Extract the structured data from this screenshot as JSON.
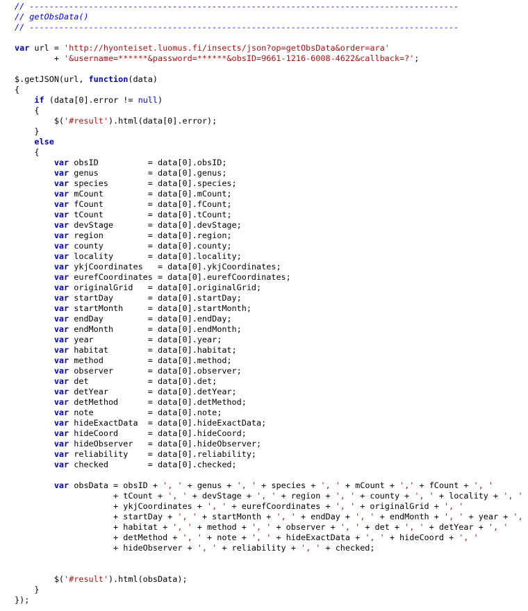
{
  "editor": {
    "lines": [
      [
        {
          "t": "comment",
          "v": "// ---------------------------------------------------------------------------------------"
        }
      ],
      [
        {
          "t": "comment",
          "v": "// getObsData()"
        }
      ],
      [
        {
          "t": "comment",
          "v": "// ---------------------------------------------------------------------------------------"
        }
      ],
      [],
      [
        {
          "t": "keyword",
          "v": "var"
        },
        {
          "t": "plain",
          "v": " url = "
        },
        {
          "t": "string",
          "v": "'http://hyonteiset.luomus.fi/insects/json?op=getObsData&order=ara'"
        }
      ],
      [
        {
          "t": "plain",
          "v": "        + "
        },
        {
          "t": "string",
          "v": "'&username=******&password=******&obsID=9661-1216-6008-4622&callback=?'"
        },
        {
          "t": "plain",
          "v": ";"
        }
      ],
      [],
      [
        {
          "t": "plain",
          "v": "$.getJSON(url, "
        },
        {
          "t": "keyword",
          "v": "function"
        },
        {
          "t": "plain",
          "v": "(data)"
        }
      ],
      [
        {
          "t": "plain",
          "v": "{"
        }
      ],
      [
        {
          "t": "plain",
          "v": "    "
        },
        {
          "t": "keyword",
          "v": "if"
        },
        {
          "t": "plain",
          "v": " (data[0].error != "
        },
        {
          "t": "null",
          "v": "null"
        },
        {
          "t": "plain",
          "v": ")"
        }
      ],
      [
        {
          "t": "plain",
          "v": "    {"
        }
      ],
      [
        {
          "t": "plain",
          "v": "        $("
        },
        {
          "t": "string",
          "v": "'#result'"
        },
        {
          "t": "plain",
          "v": ").html(data[0].error);"
        }
      ],
      [
        {
          "t": "plain",
          "v": "    }"
        }
      ],
      [
        {
          "t": "plain",
          "v": "    "
        },
        {
          "t": "keyword",
          "v": "else"
        }
      ],
      [
        {
          "t": "plain",
          "v": "    {"
        }
      ],
      [
        {
          "t": "plain",
          "v": "        "
        },
        {
          "t": "keyword",
          "v": "var"
        },
        {
          "t": "plain",
          "v": " obsID          = data[0].obsID;"
        }
      ],
      [
        {
          "t": "plain",
          "v": "        "
        },
        {
          "t": "keyword",
          "v": "var"
        },
        {
          "t": "plain",
          "v": " genus          = data[0].genus;"
        }
      ],
      [
        {
          "t": "plain",
          "v": "        "
        },
        {
          "t": "keyword",
          "v": "var"
        },
        {
          "t": "plain",
          "v": " species        = data[0].species;"
        }
      ],
      [
        {
          "t": "plain",
          "v": "        "
        },
        {
          "t": "keyword",
          "v": "var"
        },
        {
          "t": "plain",
          "v": " mCount         = data[0].mCount;"
        }
      ],
      [
        {
          "t": "plain",
          "v": "        "
        },
        {
          "t": "keyword",
          "v": "var"
        },
        {
          "t": "plain",
          "v": " fCount         = data[0].fCount;"
        }
      ],
      [
        {
          "t": "plain",
          "v": "        "
        },
        {
          "t": "keyword",
          "v": "var"
        },
        {
          "t": "plain",
          "v": " tCount         = data[0].tCount;"
        }
      ],
      [
        {
          "t": "plain",
          "v": "        "
        },
        {
          "t": "keyword",
          "v": "var"
        },
        {
          "t": "plain",
          "v": " devStage       = data[0].devStage;"
        }
      ],
      [
        {
          "t": "plain",
          "v": "        "
        },
        {
          "t": "keyword",
          "v": "var"
        },
        {
          "t": "plain",
          "v": " region         = data[0].region;"
        }
      ],
      [
        {
          "t": "plain",
          "v": "        "
        },
        {
          "t": "keyword",
          "v": "var"
        },
        {
          "t": "plain",
          "v": " county         = data[0].county;"
        }
      ],
      [
        {
          "t": "plain",
          "v": "        "
        },
        {
          "t": "keyword",
          "v": "var"
        },
        {
          "t": "plain",
          "v": " locality       = data[0].locality;"
        }
      ],
      [
        {
          "t": "plain",
          "v": "        "
        },
        {
          "t": "keyword",
          "v": "var"
        },
        {
          "t": "plain",
          "v": " ykjCoordinates   = data[0].ykjCoordinates;"
        }
      ],
      [
        {
          "t": "plain",
          "v": "        "
        },
        {
          "t": "keyword",
          "v": "var"
        },
        {
          "t": "plain",
          "v": " eurefCoordinates = data[0].eurefCoordinates;"
        }
      ],
      [
        {
          "t": "plain",
          "v": "        "
        },
        {
          "t": "keyword",
          "v": "var"
        },
        {
          "t": "plain",
          "v": " originalGrid   = data[0].originalGrid;"
        }
      ],
      [
        {
          "t": "plain",
          "v": "        "
        },
        {
          "t": "keyword",
          "v": "var"
        },
        {
          "t": "plain",
          "v": " startDay       = data[0].startDay;"
        }
      ],
      [
        {
          "t": "plain",
          "v": "        "
        },
        {
          "t": "keyword",
          "v": "var"
        },
        {
          "t": "plain",
          "v": " startMonth     = data[0].startMonth;"
        }
      ],
      [
        {
          "t": "plain",
          "v": "        "
        },
        {
          "t": "keyword",
          "v": "var"
        },
        {
          "t": "plain",
          "v": " endDay         = data[0].endDay;"
        }
      ],
      [
        {
          "t": "plain",
          "v": "        "
        },
        {
          "t": "keyword",
          "v": "var"
        },
        {
          "t": "plain",
          "v": " endMonth       = data[0].endMonth;"
        }
      ],
      [
        {
          "t": "plain",
          "v": "        "
        },
        {
          "t": "keyword",
          "v": "var"
        },
        {
          "t": "plain",
          "v": " year           = data[0].year;"
        }
      ],
      [
        {
          "t": "plain",
          "v": "        "
        },
        {
          "t": "keyword",
          "v": "var"
        },
        {
          "t": "plain",
          "v": " habitat        = data[0].habitat;"
        }
      ],
      [
        {
          "t": "plain",
          "v": "        "
        },
        {
          "t": "keyword",
          "v": "var"
        },
        {
          "t": "plain",
          "v": " method         = data[0].method;"
        }
      ],
      [
        {
          "t": "plain",
          "v": "        "
        },
        {
          "t": "keyword",
          "v": "var"
        },
        {
          "t": "plain",
          "v": " observer       = data[0].observer;"
        }
      ],
      [
        {
          "t": "plain",
          "v": "        "
        },
        {
          "t": "keyword",
          "v": "var"
        },
        {
          "t": "plain",
          "v": " det            = data[0].det;"
        }
      ],
      [
        {
          "t": "plain",
          "v": "        "
        },
        {
          "t": "keyword",
          "v": "var"
        },
        {
          "t": "plain",
          "v": " detYear        = data[0].detYear;"
        }
      ],
      [
        {
          "t": "plain",
          "v": "        "
        },
        {
          "t": "keyword",
          "v": "var"
        },
        {
          "t": "plain",
          "v": " detMethod      = data[0].detMethod;"
        }
      ],
      [
        {
          "t": "plain",
          "v": "        "
        },
        {
          "t": "keyword",
          "v": "var"
        },
        {
          "t": "plain",
          "v": " note           = data[0].note;"
        }
      ],
      [
        {
          "t": "plain",
          "v": "        "
        },
        {
          "t": "keyword",
          "v": "var"
        },
        {
          "t": "plain",
          "v": " hideExactData  = data[0].hideExactData;"
        }
      ],
      [
        {
          "t": "plain",
          "v": "        "
        },
        {
          "t": "keyword",
          "v": "var"
        },
        {
          "t": "plain",
          "v": " hideCoord      = data[0].hideCoord;"
        }
      ],
      [
        {
          "t": "plain",
          "v": "        "
        },
        {
          "t": "keyword",
          "v": "var"
        },
        {
          "t": "plain",
          "v": " hideObserver   = data[0].hideObserver;"
        }
      ],
      [
        {
          "t": "plain",
          "v": "        "
        },
        {
          "t": "keyword",
          "v": "var"
        },
        {
          "t": "plain",
          "v": " reliability    = data[0].reliability;"
        }
      ],
      [
        {
          "t": "plain",
          "v": "        "
        },
        {
          "t": "keyword",
          "v": "var"
        },
        {
          "t": "plain",
          "v": " checked        = data[0].checked;"
        }
      ],
      [],
      [
        {
          "t": "plain",
          "v": "        "
        },
        {
          "t": "keyword",
          "v": "var"
        },
        {
          "t": "plain",
          "v": " obsData = obsID + "
        },
        {
          "t": "string",
          "v": "', '"
        },
        {
          "t": "plain",
          "v": " + genus + "
        },
        {
          "t": "string",
          "v": "', '"
        },
        {
          "t": "plain",
          "v": " + species + "
        },
        {
          "t": "string",
          "v": "', '"
        },
        {
          "t": "plain",
          "v": " + mCount + "
        },
        {
          "t": "string",
          "v": "','"
        },
        {
          "t": "plain",
          "v": " + fCount + "
        },
        {
          "t": "string",
          "v": "', '"
        }
      ],
      [
        {
          "t": "plain",
          "v": "                    + tCount + "
        },
        {
          "t": "string",
          "v": "', '"
        },
        {
          "t": "plain",
          "v": " + devStage + "
        },
        {
          "t": "string",
          "v": "', '"
        },
        {
          "t": "plain",
          "v": " + region + "
        },
        {
          "t": "string",
          "v": "', '"
        },
        {
          "t": "plain",
          "v": " + county + "
        },
        {
          "t": "string",
          "v": "', '"
        },
        {
          "t": "plain",
          "v": " + locality + "
        },
        {
          "t": "string",
          "v": "', '"
        }
      ],
      [
        {
          "t": "plain",
          "v": "                    + ykjCoordinates + "
        },
        {
          "t": "string",
          "v": "', '"
        },
        {
          "t": "plain",
          "v": " + eurefCoordinates + "
        },
        {
          "t": "string",
          "v": "', '"
        },
        {
          "t": "plain",
          "v": " + originalGrid + "
        },
        {
          "t": "string",
          "v": "', '"
        }
      ],
      [
        {
          "t": "plain",
          "v": "                    + startDay + "
        },
        {
          "t": "string",
          "v": "', '"
        },
        {
          "t": "plain",
          "v": " + startMonth + "
        },
        {
          "t": "string",
          "v": "', '"
        },
        {
          "t": "plain",
          "v": " + endDay + "
        },
        {
          "t": "string",
          "v": "', '"
        },
        {
          "t": "plain",
          "v": " + endMonth + "
        },
        {
          "t": "string",
          "v": "', '"
        },
        {
          "t": "plain",
          "v": " + year + "
        },
        {
          "t": "string",
          "v": "', '"
        }
      ],
      [
        {
          "t": "plain",
          "v": "                    + habitat + "
        },
        {
          "t": "string",
          "v": "', '"
        },
        {
          "t": "plain",
          "v": " + method + "
        },
        {
          "t": "string",
          "v": "', '"
        },
        {
          "t": "plain",
          "v": " + observer + "
        },
        {
          "t": "string",
          "v": "', '"
        },
        {
          "t": "plain",
          "v": " + det + "
        },
        {
          "t": "string",
          "v": "', '"
        },
        {
          "t": "plain",
          "v": " + detYear + "
        },
        {
          "t": "string",
          "v": "', '"
        }
      ],
      [
        {
          "t": "plain",
          "v": "                    + detMethod + "
        },
        {
          "t": "string",
          "v": "', '"
        },
        {
          "t": "plain",
          "v": " + note + "
        },
        {
          "t": "string",
          "v": "', '"
        },
        {
          "t": "plain",
          "v": " + hideExactData + "
        },
        {
          "t": "string",
          "v": "', '"
        },
        {
          "t": "plain",
          "v": " + hideCoord + "
        },
        {
          "t": "string",
          "v": "', '"
        }
      ],
      [
        {
          "t": "plain",
          "v": "                    + hideObserver + "
        },
        {
          "t": "string",
          "v": "', '"
        },
        {
          "t": "plain",
          "v": " + reliability + "
        },
        {
          "t": "string",
          "v": "', '"
        },
        {
          "t": "plain",
          "v": " + checked;"
        }
      ],
      [],
      [],
      [
        {
          "t": "plain",
          "v": "        $("
        },
        {
          "t": "string",
          "v": "'#result'"
        },
        {
          "t": "plain",
          "v": ").html(obsData);"
        }
      ],
      [
        {
          "t": "plain",
          "v": "    }"
        }
      ],
      [
        {
          "t": "plain",
          "v": "});"
        }
      ]
    ]
  },
  "colors": {
    "comment": "#0000ff",
    "keyword": "#0000b0",
    "string": "#a31515",
    "plain": "#000000",
    "background": "#ffffff"
  }
}
